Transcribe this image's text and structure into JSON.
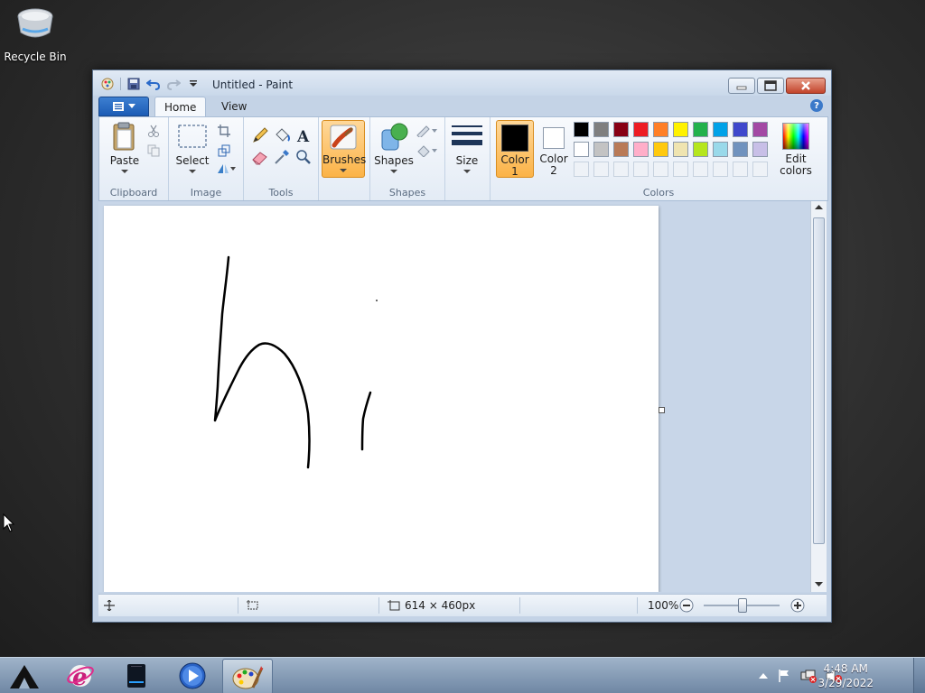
{
  "desktop": {
    "icons": [
      {
        "label": "Recycle Bin",
        "icon": "recycle-bin-icon"
      }
    ]
  },
  "window": {
    "title": "Untitled - Paint",
    "quick_access": [
      "paint-app-icon",
      "save-icon",
      "undo-icon",
      "redo-icon",
      "customize-dropdown-icon"
    ],
    "controls": [
      "minimize",
      "maximize",
      "close"
    ]
  },
  "ribbon": {
    "tabs": [
      {
        "label": "Home",
        "active": true
      },
      {
        "label": "View",
        "active": false
      }
    ],
    "groups": {
      "clipboard": {
        "label": "Clipboard",
        "paste": "Paste"
      },
      "image": {
        "label": "Image",
        "select": "Select"
      },
      "tools": {
        "label": "Tools",
        "items": [
          "pencil",
          "fill",
          "text",
          "eraser",
          "color-picker",
          "magnifier"
        ]
      },
      "brushes": {
        "label": "Brushes",
        "selected": true
      },
      "shapes": {
        "label": "Shapes",
        "shapes": "Shapes"
      },
      "size": {
        "label": "Size"
      },
      "colors": {
        "label": "Colors",
        "color1": {
          "label_1": "Color",
          "label_2": "1",
          "value": "#000000"
        },
        "color2": {
          "label_1": "Color",
          "label_2": "2",
          "value": "#ffffff"
        },
        "edit": {
          "label_1": "Edit",
          "label_2": "colors"
        },
        "palette_row1": [
          "#000000",
          "#7f7f7f",
          "#880015",
          "#ed1c24",
          "#ff7f27",
          "#fff200",
          "#22b14c",
          "#00a2e8",
          "#3f48cc",
          "#a349a4"
        ],
        "palette_row2": [
          "#ffffff",
          "#c3c3c3",
          "#b97a57",
          "#ffaec9",
          "#ffc90e",
          "#efe4b0",
          "#b5e61d",
          "#99d9ea",
          "#7092be",
          "#c8bfe7"
        ]
      }
    }
  },
  "status": {
    "canvas_size": "614 × 460px",
    "zoom": "100%"
  },
  "taskbar": {
    "apps": [
      "start-icon",
      "internet-explorer-icon",
      "file-manager-icon",
      "media-player-icon",
      "paint-icon"
    ],
    "time": "4:48 AM",
    "date": "3/29/2022"
  }
}
